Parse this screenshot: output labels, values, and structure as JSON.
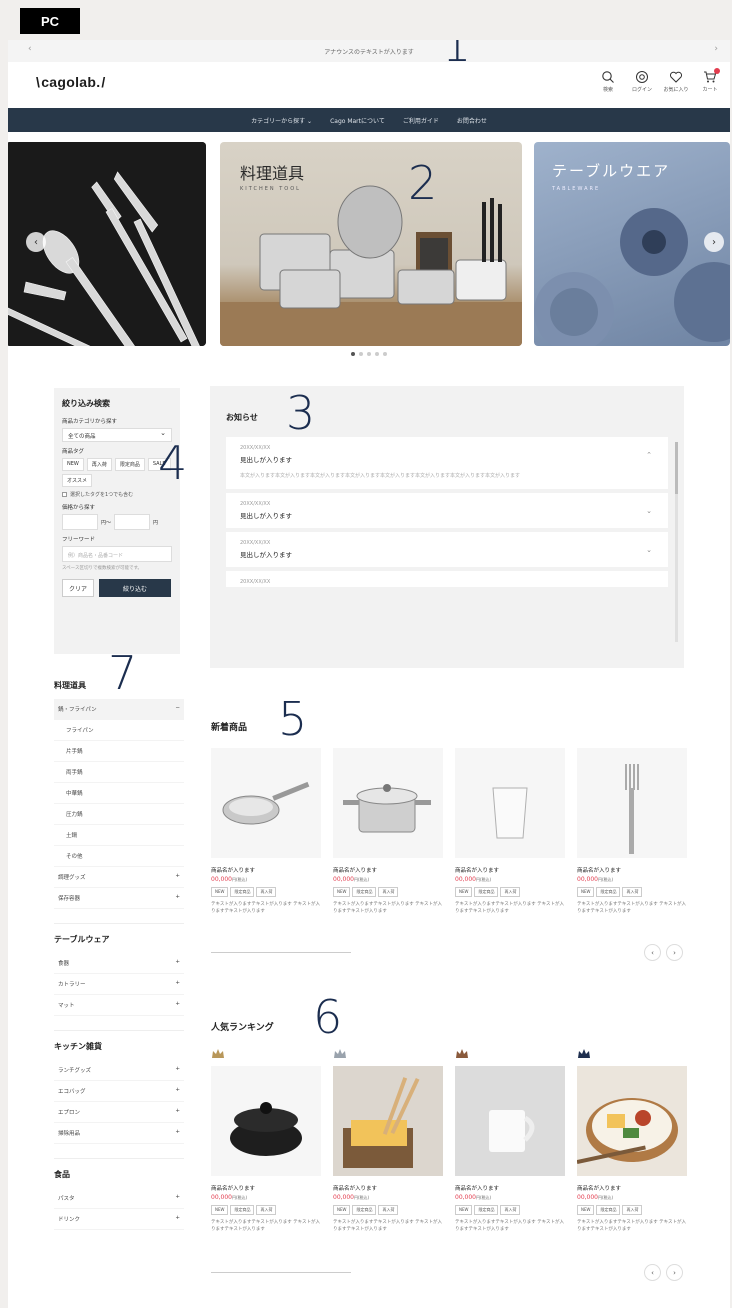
{
  "badge": "PC",
  "annotation_numbers": [
    "1",
    "2",
    "3",
    "4",
    "5",
    "6",
    "7"
  ],
  "announcement": "アナウンスのテキストが入ります",
  "header": {
    "logo": "cagolab.",
    "icons": [
      {
        "icon": "search-icon",
        "label": "検索"
      },
      {
        "icon": "login-icon",
        "label": "ログイン"
      },
      {
        "icon": "heart-icon",
        "label": "お気に入り"
      },
      {
        "icon": "cart-icon",
        "label": "カート"
      }
    ]
  },
  "gnav": [
    "カテゴリーから探す ⌄",
    "Cago Martについて",
    "ご利用ガイド",
    "お問合わせ"
  ],
  "hero": {
    "slide2_title": "料理道具",
    "slide2_sub": "KITCHEN TOOL",
    "slide3_title": "テーブルウエア",
    "slide3_sub": "TABLEWARE",
    "prev": "‹",
    "next": "›"
  },
  "filter": {
    "title": "絞り込み検索",
    "category_label": "商品カテゴリから探す",
    "category_value": "全ての商品",
    "tag_label": "商品タグ",
    "tags": [
      "NEW",
      "再入荷",
      "限定商品",
      "SALE",
      "オススメ"
    ],
    "check_label": "選択したタグを1つでも含む",
    "price_label": "価格から探す",
    "price_from": "円〜",
    "price_to": "円",
    "keyword_label": "フリーワード",
    "keyword_placeholder": "例）商品名・品番コード",
    "keyword_note": "スペース区切りで複数検索が可能です。",
    "clear": "クリア",
    "submit": "絞り込む"
  },
  "sidebar": {
    "cooking_title": "料理道具",
    "cooking_items": [
      {
        "label": "鍋・フライパン",
        "sign": "−",
        "active": true
      }
    ],
    "cooking_subs": [
      "フライパン",
      "片手鍋",
      "両手鍋",
      "中華鍋",
      "圧力鍋",
      "土鍋",
      "その他"
    ],
    "cooking_more": [
      {
        "label": "調理グッズ",
        "sign": "+"
      },
      {
        "label": "保存容器",
        "sign": "+"
      }
    ],
    "table_title": "テーブルウェア",
    "table_items": [
      {
        "label": "食器",
        "sign": "+"
      },
      {
        "label": "カトラリー",
        "sign": "+"
      },
      {
        "label": "マット",
        "sign": "+"
      }
    ],
    "kitchen_title": "キッチン雑貨",
    "kitchen_items": [
      {
        "label": "ランチグッズ",
        "sign": "+"
      },
      {
        "label": "エコバッグ",
        "sign": "+"
      },
      {
        "label": "エプロン",
        "sign": "+"
      },
      {
        "label": "掃除用品",
        "sign": "+"
      }
    ],
    "food_title": "食品",
    "food_items": [
      {
        "label": "パスタ",
        "sign": "+"
      },
      {
        "label": "ドリンク",
        "sign": "+"
      }
    ]
  },
  "news": {
    "title": "お知らせ",
    "items": [
      {
        "date": "20XX/XX/XX",
        "head": "見出しが入ります",
        "chev": "⌃",
        "body": "本文が入ります本文が入ります本文が入ります本文が入ります本文が入ります本文が入ります本文が入ります本文が入ります"
      },
      {
        "date": "20XX/XX/XX",
        "head": "見出しが入ります",
        "chev": "⌄"
      },
      {
        "date": "20XX/XX/XX",
        "head": "見出しが入ります",
        "chev": "⌄"
      },
      {
        "date": "20XX/XX/XX",
        "head": "",
        "chev": ""
      }
    ]
  },
  "new_arrivals": {
    "title": "新着商品",
    "products": [
      {
        "name": "商品名が入ります",
        "price": "00,000",
        "tax": "円(税込)",
        "tags": [
          "NEW",
          "限定商品",
          "再入荷"
        ],
        "desc": "テキストが入りますテキストが入ります テキストが入りますテキストが入ります",
        "img": "pan"
      },
      {
        "name": "商品名が入ります",
        "price": "00,000",
        "tax": "円(税込)",
        "tags": [
          "NEW",
          "限定商品",
          "再入荷"
        ],
        "desc": "テキストが入りますテキストが入ります テキストが入りますテキストが入ります",
        "img": "pot"
      },
      {
        "name": "商品名が入ります",
        "price": "00,000",
        "tax": "円(税込)",
        "tags": [
          "NEW",
          "限定商品",
          "再入荷"
        ],
        "desc": "テキストが入りますテキストが入ります テキストが入りますテキストが入ります",
        "img": "glass"
      },
      {
        "name": "商品名が入ります",
        "price": "00,000",
        "tax": "円(税込)",
        "tags": [
          "NEW",
          "限定商品",
          "再入荷"
        ],
        "desc": "テキストが入りますテキストが入ります テキストが入りますテキストが入ります",
        "img": "fork"
      }
    ]
  },
  "ranking": {
    "title": "人気ランキング",
    "crown_colors": [
      "#b8975a",
      "#9aa3ad",
      "#8a5a3c",
      "#1f2f4f"
    ],
    "products": [
      {
        "name": "商品名が入ります",
        "price": "00,000",
        "tax": "円(税込)",
        "tags": [
          "NEW",
          "限定商品",
          "再入荷"
        ],
        "desc": "テキストが入りますテキストが入ります テキストが入りますテキストが入ります",
        "img": "donabe"
      },
      {
        "name": "商品名が入ります",
        "price": "00,000",
        "tax": "円(税込)",
        "tags": [
          "NEW",
          "限定商品",
          "再入荷"
        ],
        "desc": "テキストが入りますテキストが入ります テキストが入りますテキストが入ります",
        "img": "tamago"
      },
      {
        "name": "商品名が入ります",
        "price": "00,000",
        "tax": "円(税込)",
        "tags": [
          "NEW",
          "限定商品",
          "再入荷"
        ],
        "desc": "テキストが入りますテキストが入ります テキストが入りますテキストが入ります",
        "img": "mug"
      },
      {
        "name": "商品名が入ります",
        "price": "00,000",
        "tax": "円(税込)",
        "tags": [
          "NEW",
          "限定商品",
          "再入荷"
        ],
        "desc": "テキストが入りますテキストが入ります テキストが入りますテキストが入ります",
        "img": "bento"
      }
    ]
  },
  "pager": {
    "prev": "‹",
    "next": "›"
  },
  "colors": {
    "nav": "#283849",
    "accent": "#e23c4e",
    "badge": "#000000"
  }
}
